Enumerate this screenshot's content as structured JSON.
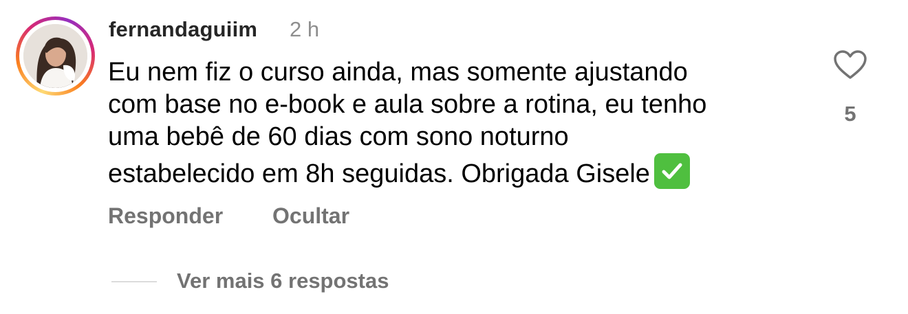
{
  "comment": {
    "username": "fernandaguiim",
    "timestamp": "2 h",
    "text_lines": [
      "Eu nem fiz o curso ainda, mas somente ajustando",
      "com base no e-book e aula sobre a rotina, eu tenho",
      "uma bebê de 60 dias com sono noturno",
      "estabelecido em 8h seguidas.  Obrigada Gisele"
    ],
    "emoji_icon": "check-mark-button-icon",
    "likes": "5",
    "reply_label": "Responder",
    "hide_label": "Ocultar"
  },
  "replies": {
    "view_more_label": "Ver mais 6 respostas"
  },
  "icons": {
    "like": "heart-outline-icon",
    "avatar": "profile-photo"
  },
  "colors": {
    "username": "#262626",
    "secondary_text": "#737373",
    "timestamp": "#8e8e8e",
    "check_green": "#4fbf3f",
    "divider": "#dbdbdb"
  }
}
